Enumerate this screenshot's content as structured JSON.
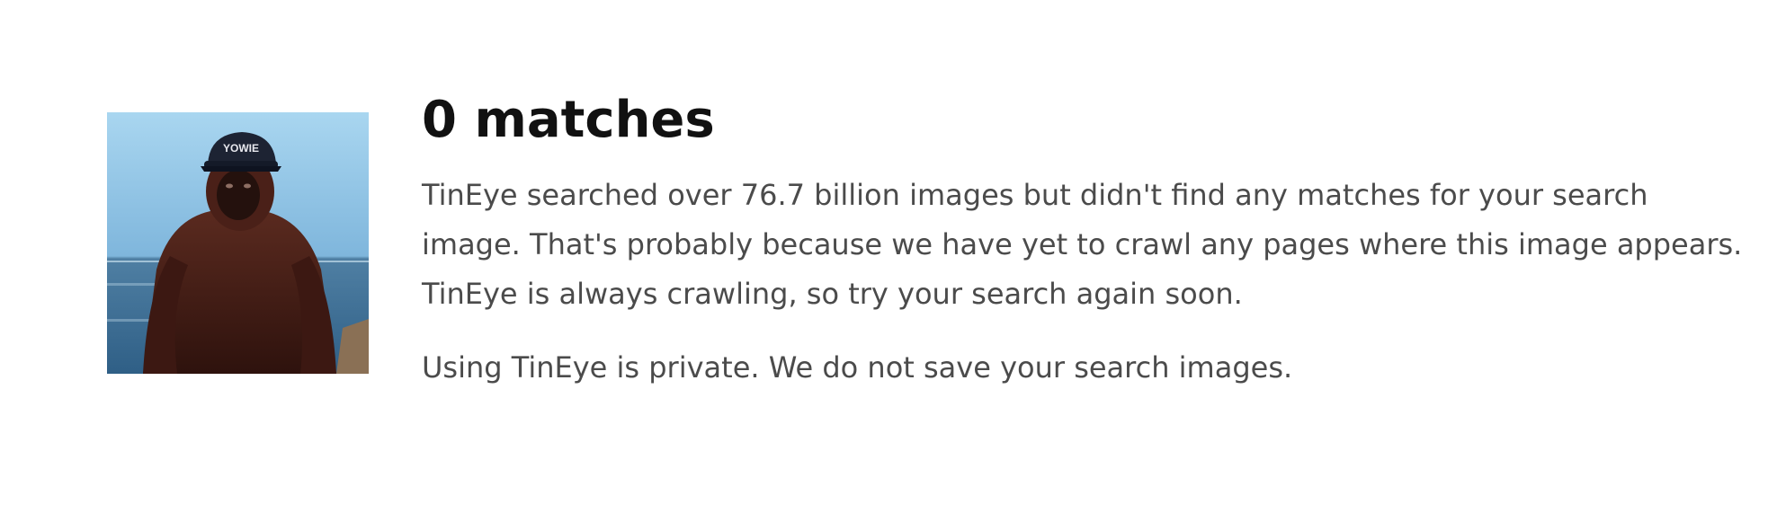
{
  "result": {
    "match_count": "0 matches",
    "explanation": "TinEye searched over 76.7 billion images but didn't find any matches for your search image. That's probably because we have yet to crawl any pages where this image appears. TinEye is always crawling, so try your search again soon.",
    "privacy_note": "Using TinEye is private. We do not save your search images."
  },
  "query_image": {
    "cap_text": "YOWIE"
  }
}
